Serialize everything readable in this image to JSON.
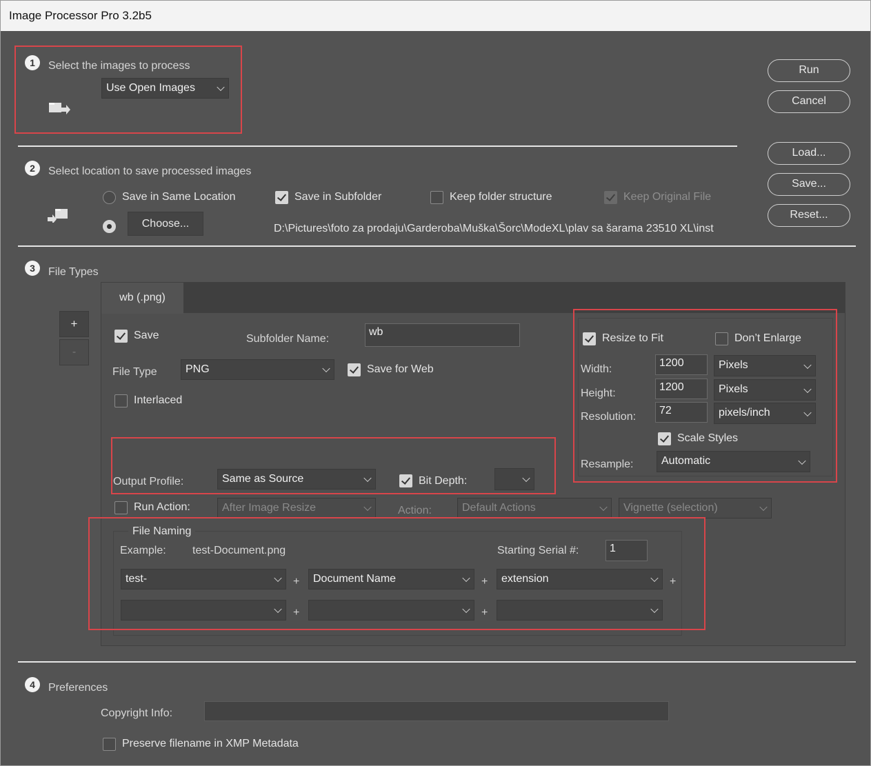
{
  "window": {
    "title": "Image Processor Pro 3.2b5"
  },
  "section1": {
    "number": "1",
    "title": "Select the images to process",
    "source_select": "Use Open Images"
  },
  "section2": {
    "number": "2",
    "title": "Select location to save processed images",
    "save_same_location": "Save in Same Location",
    "save_in_subfolder": "Save in Subfolder",
    "keep_folder_structure": "Keep folder structure",
    "keep_original_file": "Keep Original File",
    "choose_button": "Choose...",
    "path": "D:\\Pictures\\foto za prodaju\\Garderoba\\Muška\\Šorc\\ModeXL\\plav sa šarama 23510 XL\\inst"
  },
  "section3": {
    "number": "3",
    "title": "File Types",
    "add_button": "+",
    "remove_button": "-",
    "tab_label": "wb (.png)",
    "save_label": "Save",
    "subfolder_name_label": "Subfolder Name:",
    "subfolder_name_value": "wb",
    "file_type_label": "File Type",
    "file_type_value": "PNG",
    "save_for_web": "Save for Web",
    "interlaced": "Interlaced",
    "output_profile_label": "Output Profile:",
    "output_profile_value": "Same as Source",
    "bit_depth_label": "Bit Depth:",
    "bit_depth_value": "",
    "run_action_label": "Run Action:",
    "run_action_value": "After Image Resize",
    "action_label": "Action:",
    "action_set_value": "Default Actions",
    "action_value": "Vignette (selection)",
    "resize": {
      "resize_to_fit": "Resize to Fit",
      "dont_enlarge": "Don’t Enlarge",
      "width_label": "Width:",
      "width_value": "1200",
      "width_unit": "Pixels",
      "height_label": "Height:",
      "height_value": "1200",
      "height_unit": "Pixels",
      "resolution_label": "Resolution:",
      "resolution_value": "72",
      "resolution_unit": "pixels/inch",
      "scale_styles": "Scale Styles",
      "resample_label": "Resample:",
      "resample_value": "Automatic"
    },
    "naming": {
      "title": "File Naming",
      "example_label": "Example:",
      "example_value": "test-Document.png",
      "serial_label": "Starting Serial #:",
      "serial_value": "1",
      "row1": [
        "test-",
        "Document Name",
        "extension"
      ],
      "row2": [
        "",
        "",
        ""
      ],
      "plus": "+"
    }
  },
  "section4": {
    "number": "4",
    "title": "Preferences",
    "copyright_label": "Copyright Info:",
    "copyright_value": "",
    "preserve_filename": "Preserve filename in XMP Metadata"
  },
  "buttons": {
    "run": "Run",
    "cancel": "Cancel",
    "load": "Load...",
    "save": "Save...",
    "reset": "Reset..."
  },
  "colors": {
    "background": "#535353",
    "highlight": "#d9454a",
    "titlebar": "#f3f3f3"
  }
}
